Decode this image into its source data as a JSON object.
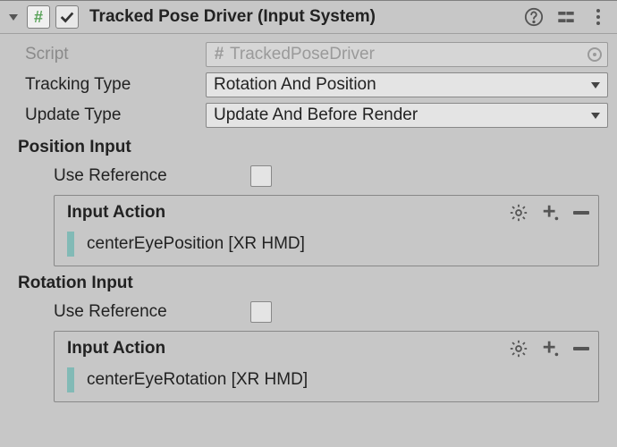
{
  "header": {
    "title": "Tracked Pose Driver (Input System)"
  },
  "fields": {
    "script_label": "Script",
    "script_value": "TrackedPoseDriver",
    "tracking_type_label": "Tracking Type",
    "tracking_type_value": "Rotation And Position",
    "update_type_label": "Update Type",
    "update_type_value": "Update And Before Render"
  },
  "sections": {
    "position": {
      "title": "Position Input",
      "use_reference_label": "Use Reference",
      "input_action_label": "Input Action",
      "binding": "centerEyePosition [XR HMD]"
    },
    "rotation": {
      "title": "Rotation Input",
      "use_reference_label": "Use Reference",
      "input_action_label": "Input Action",
      "binding": "centerEyeRotation [XR HMD]"
    }
  }
}
